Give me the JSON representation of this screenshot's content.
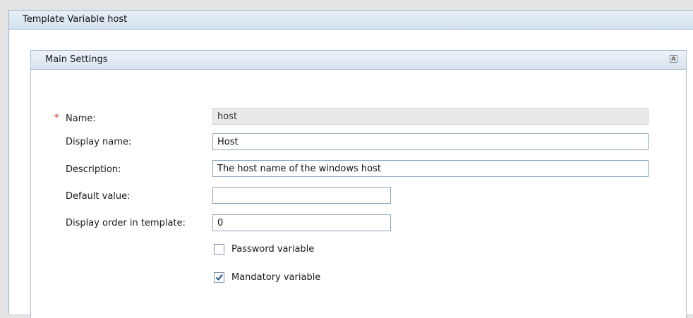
{
  "window": {
    "title": "Template Variable host"
  },
  "panel": {
    "title": "Main Settings",
    "collapse_icon": "double-chevron-up-icon"
  },
  "form": {
    "name_label": "Name:",
    "required_marker": "*",
    "name_value": "host",
    "display_name_label": "Display name:",
    "display_name_value": "Host",
    "description_label": "Description:",
    "description_value": "The host name of the windows host",
    "default_value_label": "Default value:",
    "default_value_value": "",
    "display_order_label": "Display order in template:",
    "display_order_value": "0",
    "password_label": "Password variable",
    "password_checked": false,
    "mandatory_label": "Mandatory variable",
    "mandatory_checked": true
  }
}
